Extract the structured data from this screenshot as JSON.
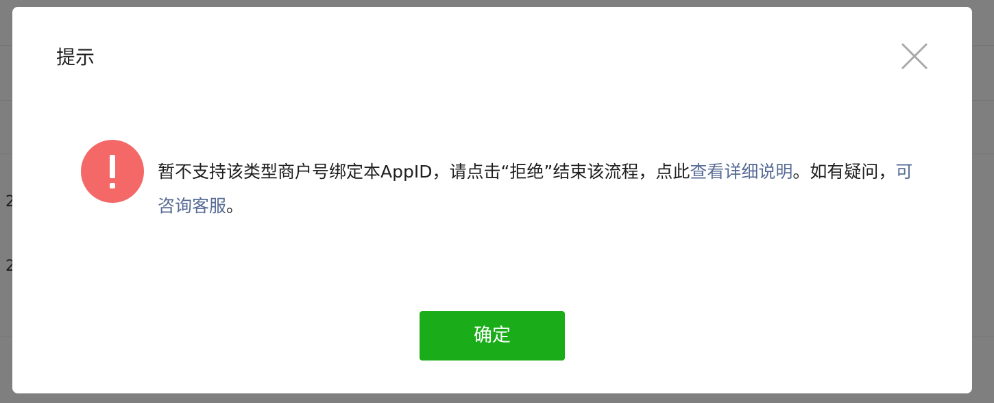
{
  "background": {
    "row_digits": [
      "2",
      "2"
    ]
  },
  "dialog": {
    "title": "提示",
    "close_icon": "close-icon",
    "alert_icon": "exclamation-circle-icon",
    "alert_color": "#f56868",
    "message": {
      "text_before_link": "暂不支持该类型商户号绑定本AppID，请点击“拒绝”结束该流程，点此",
      "detail_link": "查看详细说明",
      "text_between": "。如有疑问，",
      "service_link": "可咨询客服",
      "text_after": "。"
    },
    "link_color": "#576b95",
    "confirm_label": "确定",
    "confirm_color": "#1aad19"
  }
}
